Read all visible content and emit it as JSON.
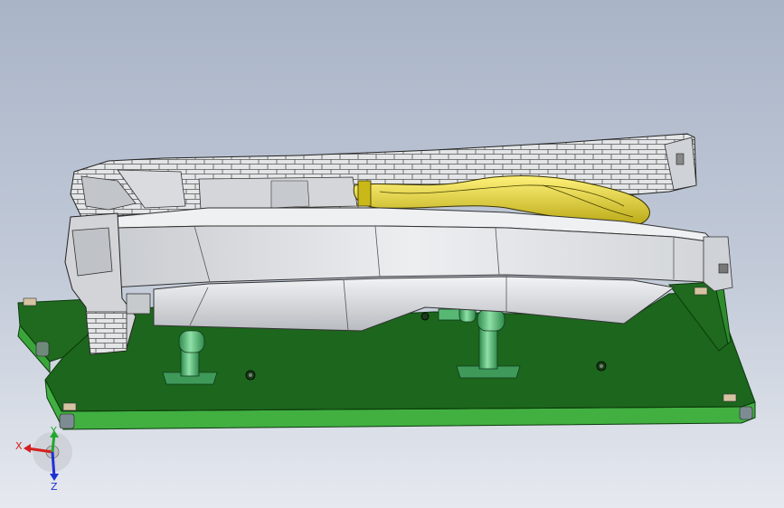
{
  "triad": {
    "x_label": "X",
    "y_label": "Y",
    "z_label": "Z",
    "x_color": "#d42020",
    "y_color": "#1fa82e",
    "z_color": "#2030d8"
  },
  "colors": {
    "background_top": "#a9b4c7",
    "background_bottom": "#e6e9ef",
    "base_plate": "#1f6b1f",
    "base_edge": "#3aa83a",
    "part_shell": "#d7d9dc",
    "inner_part": "#d8c820",
    "support": "#52b070",
    "edge_lines": "#333333"
  },
  "components": [
    "fixture-base-plate",
    "support-post",
    "trim-panel",
    "inner-duct",
    "triad"
  ]
}
